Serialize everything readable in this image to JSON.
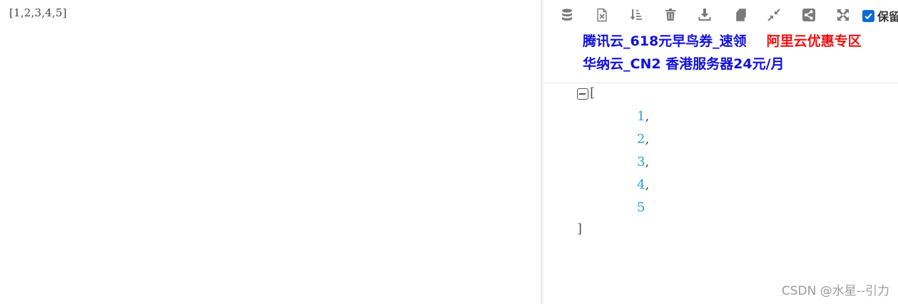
{
  "raw_text": "[1,2,3,4,5]",
  "toolbar": {
    "buttons": [
      {
        "name": "database-icon"
      },
      {
        "name": "excel-export-icon"
      },
      {
        "name": "sort-icon"
      },
      {
        "name": "trash-icon"
      },
      {
        "name": "download-icon"
      },
      {
        "name": "copy-icon"
      },
      {
        "name": "compress-icon"
      },
      {
        "name": "share-icon"
      },
      {
        "name": "expand-icon"
      }
    ],
    "keep_label": "保留",
    "keep_checked": true
  },
  "ads": {
    "row1": [
      {
        "text": "腾讯云_618元早鸟券_速领",
        "color": "#1111dd"
      },
      {
        "text": "阿里云优惠专区",
        "color": "#ee1111"
      }
    ],
    "row2": [
      {
        "text": "华纳云_CN2 香港服务器24元/月",
        "color": "#1111dd"
      }
    ]
  },
  "json_view": {
    "open_bracket": "[",
    "close_bracket": "]",
    "items": [
      {
        "value": "1",
        "sep": ","
      },
      {
        "value": "2",
        "sep": ","
      },
      {
        "value": "3",
        "sep": ","
      },
      {
        "value": "4",
        "sep": ","
      },
      {
        "value": "5",
        "sep": ""
      }
    ],
    "value_color": "#2aa0d8"
  },
  "watermark": "CSDN @水星--引力"
}
